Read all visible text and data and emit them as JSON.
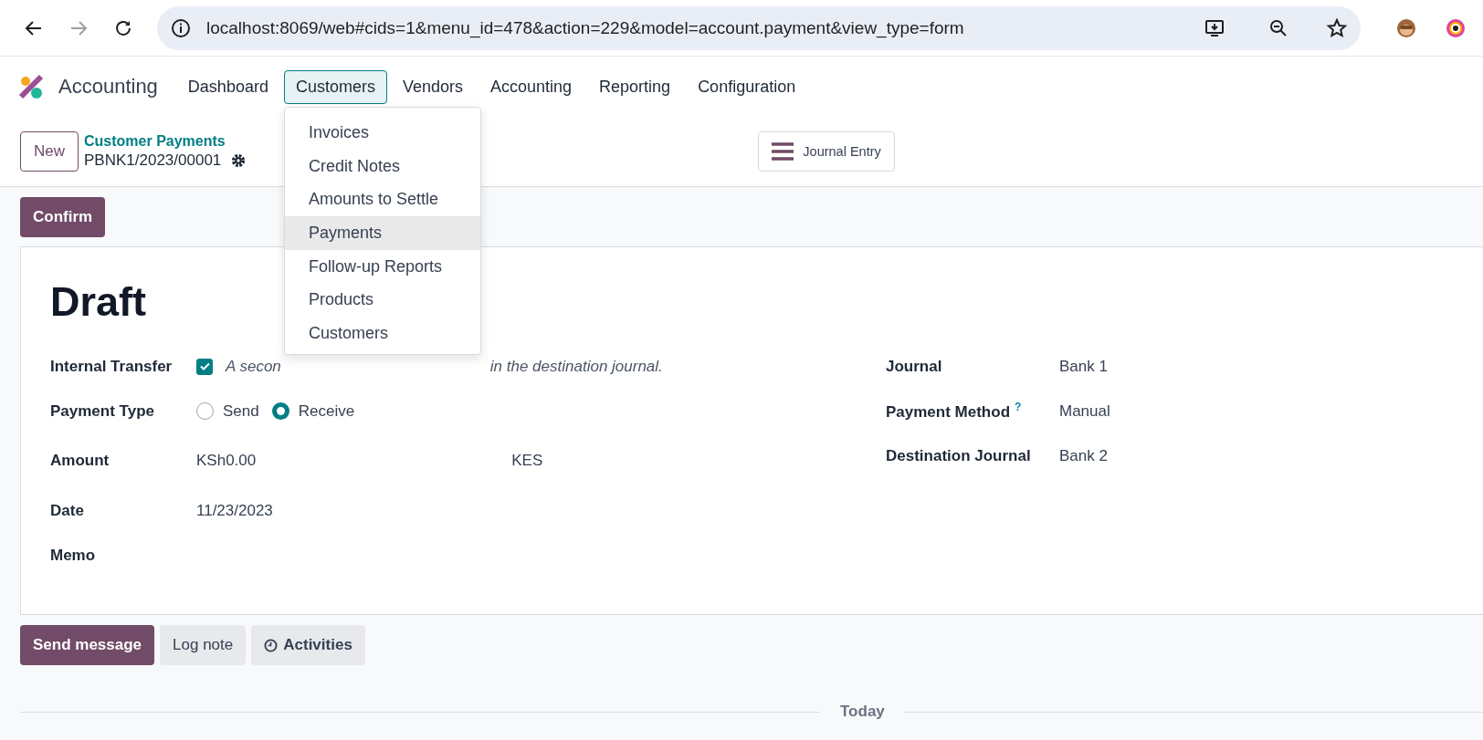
{
  "browser": {
    "url": "localhost:8069/web#cids=1&menu_id=478&action=229&model=account.payment&view_type=form"
  },
  "app": {
    "name": "Accounting",
    "menu": [
      {
        "label": "Dashboard",
        "selected": false
      },
      {
        "label": "Customers",
        "selected": true
      },
      {
        "label": "Vendors",
        "selected": false
      },
      {
        "label": "Accounting",
        "selected": false
      },
      {
        "label": "Reporting",
        "selected": false
      },
      {
        "label": "Configuration",
        "selected": false
      }
    ]
  },
  "dropdown": {
    "items": [
      {
        "label": "Invoices",
        "selected": false
      },
      {
        "label": "Credit Notes",
        "selected": false
      },
      {
        "label": "Amounts to Settle",
        "selected": false
      },
      {
        "label": "Payments",
        "selected": true
      },
      {
        "label": "Follow-up Reports",
        "selected": false
      },
      {
        "label": "Products",
        "selected": false
      },
      {
        "label": "Customers",
        "selected": false
      }
    ]
  },
  "control_panel": {
    "new_button": "New",
    "breadcrumb": "Customer Payments",
    "record": "PBNK1/2023/00001",
    "smart_button": "Journal Entry"
  },
  "status_button": "Confirm",
  "form": {
    "title": "Draft",
    "left": [
      {
        "kind": "checkbox",
        "label": "Internal Transfer",
        "checked": true,
        "help_parts": [
          "A secon",
          "in the destination journal."
        ]
      },
      {
        "kind": "radio",
        "label": "Payment Type",
        "options": [
          {
            "label": "Send",
            "selected": false
          },
          {
            "label": "Receive",
            "selected": true
          }
        ]
      },
      {
        "kind": "amount",
        "label": "Amount",
        "value": "KSh0.00",
        "currency": "KES"
      },
      {
        "kind": "text",
        "label": "Date",
        "value": "11/23/2023"
      },
      {
        "kind": "text",
        "label": "Memo"
      }
    ],
    "right": [
      {
        "label": "Journal",
        "value": "Bank 1"
      },
      {
        "label": "Payment Method",
        "help_mark": "?",
        "value": "Manual"
      },
      {
        "label": "Destination Journal",
        "value": "Bank 2"
      }
    ]
  },
  "chatter": {
    "buttons": [
      {
        "label": "Send message",
        "kind": "primary"
      },
      {
        "label": "Log note",
        "kind": "secondary"
      },
      {
        "label": "Activities",
        "kind": "activities"
      }
    ],
    "separator": "Today"
  }
}
